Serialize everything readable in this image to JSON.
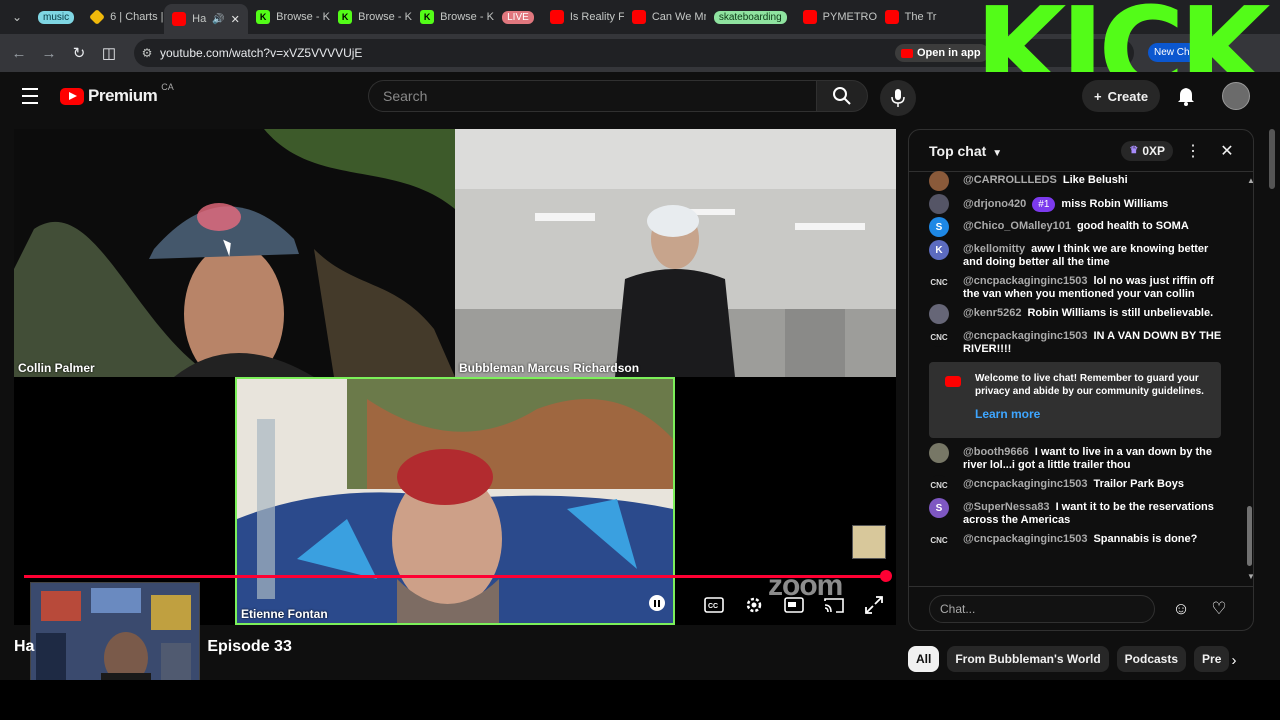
{
  "browser": {
    "tabs": [
      {
        "label": "music",
        "kind": "pill-music"
      },
      {
        "label": "6 | Charts |",
        "kind": "bn"
      },
      {
        "label": "Ha",
        "kind": "yt",
        "active": true
      },
      {
        "label": "Browse - K",
        "kind": "kick"
      },
      {
        "label": "Browse - K",
        "kind": "kick"
      },
      {
        "label": "Browse - K",
        "kind": "kick"
      },
      {
        "label": "LIVE",
        "kind": "pill-live"
      },
      {
        "label": "Is Reality F",
        "kind": "yt"
      },
      {
        "label": "Can We Mr",
        "kind": "yt"
      },
      {
        "label": "skateboarding",
        "kind": "pill-skate"
      },
      {
        "label": "PYMETROZ",
        "kind": "yt"
      },
      {
        "label": "The Tr",
        "kind": "yt"
      }
    ],
    "url": "youtube.com/watch?v=xVZ5VVVVUjE",
    "open_in_app": "Open in app",
    "new_chrome": "New Chro",
    "overlay_text": "KICK"
  },
  "masthead": {
    "brand": "Premium",
    "region": "CA",
    "search_placeholder": "Search",
    "create_label": "Create"
  },
  "video": {
    "participants": [
      {
        "name": "Collin Palmer"
      },
      {
        "name": "Bubbleman Marcus Richardson"
      },
      {
        "name": "Etienne Fontan"
      }
    ],
    "watermark": "zoom",
    "progress_fraction": 0.99,
    "title_visible": "Ha",
    "title_suffix": "Episode 33"
  },
  "chat": {
    "title": "Top chat",
    "xp": "0XP",
    "messages": [
      {
        "author": "@CARROLLLEDS",
        "text": "Like Belushi",
        "avatar": "",
        "avatar_color": "#8a5a3a"
      },
      {
        "author": "@drjono420",
        "badge": "#1",
        "text": "miss Robin Williams",
        "avatar": "",
        "avatar_color": "#556"
      },
      {
        "author": "@Chico_OMalley101",
        "text": "good health to SOMA",
        "avatar": "S",
        "avatar_color": "#1e88e5"
      },
      {
        "author": "@kellomitty",
        "text": "aww I think we are knowing better and doing better all the time",
        "avatar": "K",
        "avatar_color": "#5c6bc0"
      },
      {
        "author": "@cncpackaginginc1503",
        "text": "lol no was just riffin off the van when you mentioned your van collin",
        "avatar": "CNC",
        "avatar_color": "#0f0f0f"
      },
      {
        "author": "@kenr5262",
        "text": "Robin Williams is still unbelievable.",
        "avatar": "",
        "avatar_color": "#667"
      },
      {
        "author": "@cncpackaginginc1503",
        "text": "IN A VAN DOWN BY THE RIVER!!!!",
        "avatar": "CNC",
        "avatar_color": "#0f0f0f"
      }
    ],
    "welcome": {
      "text": "Welcome to live chat! Remember to guard your privacy and abide by our community guidelines.",
      "link": "Learn more"
    },
    "messages_after": [
      {
        "author": "@booth9666",
        "text": "I want to live in a van down by the river lol...i got a little trailer thou",
        "avatar": "",
        "avatar_color": "#776"
      },
      {
        "author": "@cncpackaginginc1503",
        "text": "Trailor Park Boys",
        "avatar": "CNC",
        "avatar_color": "#0f0f0f"
      },
      {
        "author": "@SuperNessa83",
        "text": "I want it to be the reservations across the Americas",
        "avatar": "S",
        "avatar_color": "#7e57c2"
      },
      {
        "author": "@cncpackaginginc1503",
        "text": "Spannabis is done?",
        "avatar": "CNC",
        "avatar_color": "#0f0f0f"
      }
    ],
    "input_placeholder": "Chat..."
  },
  "chips": [
    "All",
    "From Bubbleman's World",
    "Podcasts",
    "Pre"
  ],
  "colors": {
    "accent": "#ff0033",
    "kick_green": "#53fc18",
    "speaker_border": "#7cf05a",
    "link": "#3ea6ff"
  }
}
